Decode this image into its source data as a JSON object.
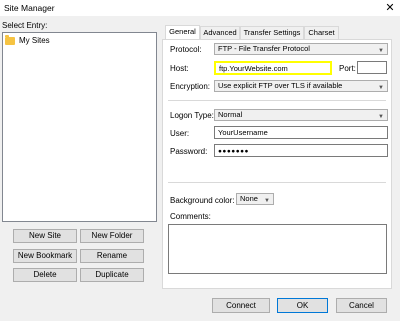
{
  "window": {
    "title": "Site Manager",
    "close_glyph": "✕"
  },
  "left": {
    "select_entry_label": "Select Entry:",
    "tree_items": [
      "My Sites"
    ],
    "buttons": {
      "new_site": "New Site",
      "new_folder": "New Folder",
      "new_bookmark": "New Bookmark",
      "rename": "Rename",
      "delete": "Delete",
      "duplicate": "Duplicate"
    }
  },
  "tabs": [
    "General",
    "Advanced",
    "Transfer Settings",
    "Charset"
  ],
  "general": {
    "protocol_label": "Protocol:",
    "protocol_value": "FTP - File Transfer Protocol",
    "host_label": "Host:",
    "host_value": "ftp.YourWebsite.com",
    "port_label": "Port:",
    "port_value": "",
    "encryption_label": "Encryption:",
    "encryption_value": "Use explicit FTP over TLS if available",
    "logon_type_label": "Logon Type:",
    "logon_type_value": "Normal",
    "user_label": "User:",
    "user_value": "YourUsername",
    "password_label": "Password:",
    "password_value": "●●●●●●●",
    "background_color_label": "Background color:",
    "background_color_value": "None",
    "comments_label": "Comments:"
  },
  "footer": {
    "connect": "Connect",
    "ok": "OK",
    "cancel": "Cancel"
  },
  "colors": {
    "highlight": "#ffff00",
    "folder": "#f6c342"
  }
}
